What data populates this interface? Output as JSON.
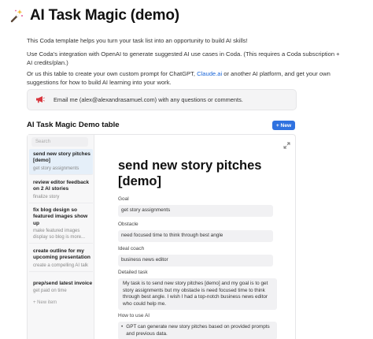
{
  "page": {
    "title": "AI Task Magic (demo)",
    "title_icon": "magic-wand-icon",
    "intro": "This Coda template helps you turn your task list into an opportunity to build AI skills!",
    "integration": "Use Coda's integration with OpenAI to generate suggested AI use cases in Coda. (This requires a Coda subscription + AI credits/plan.)",
    "prompt_before": "Or us this table to create your own custom prompt for ChatGPT, ",
    "prompt_link": "Claude.ai",
    "prompt_after": " or another AI platform, and get your own suggestions for how to build AI learning into your work."
  },
  "callout": {
    "icon": "megaphone-icon",
    "text": "Email me (alex@alexandrasamuel.com) with any questions or comments."
  },
  "table": {
    "title": "AI Task Magic Demo table",
    "new_button": "+ New",
    "search_placeholder": "Search",
    "add_item": "+  New item",
    "items": [
      {
        "title": "send new story pitches [demo]",
        "sub": "get story assignments"
      },
      {
        "title": "review editor feedback on 2 AI stories",
        "sub": "finalize story"
      },
      {
        "title": "fix blog design so featured images show up",
        "sub": "make featured images display so blog is more..."
      },
      {
        "title": "create outline for my upcoming presentation",
        "sub": "create a compelling AI talk"
      },
      {
        "title": "prep/send latest invoice",
        "sub": "get paid on time"
      }
    ]
  },
  "detail": {
    "title": "send new story pitches [demo]",
    "goal_label": "Goal",
    "goal": "get story assignments",
    "obstacle_label": "Obstacle",
    "obstacle": "need focused time to think through best angle",
    "coach_label": "Ideal coach",
    "coach": "business news editor",
    "task_label": "Detailed task",
    "task": "My task is to send new story pitches [demo] and my goal is to get story assignments but my obstacle is need focused time to think through best angle. I wish I had a top-notch business news editor who could help me.",
    "howto_label": "How to use AI",
    "howto": "GPT can generate new story pitches based on provided prompts and previous data."
  },
  "colors": {
    "accent": "#2f72e0",
    "link": "#1a66d8",
    "selected_row": "#e5eff9"
  }
}
